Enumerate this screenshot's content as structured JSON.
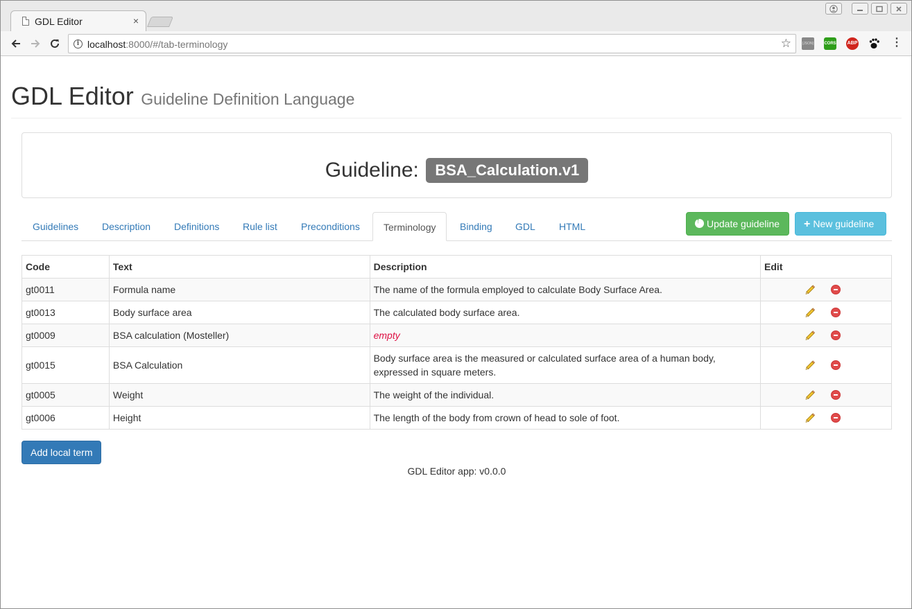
{
  "browser": {
    "tab_title": "GDL Editor",
    "tab_close": "×",
    "url_host": "localhost",
    "url_rest": ":8000/#/tab-terminology",
    "ext_cors": "CORS",
    "ext_abp": "ABP",
    "menu": "⋮"
  },
  "header": {
    "title": "GDL Editor",
    "subtitle": "Guideline Definition Language"
  },
  "guideline_panel": {
    "label": "Guideline:",
    "name": "BSA_Calculation.v1"
  },
  "tabs": [
    {
      "label": "Guidelines",
      "active": false
    },
    {
      "label": "Description",
      "active": false
    },
    {
      "label": "Definitions",
      "active": false
    },
    {
      "label": "Rule list",
      "active": false
    },
    {
      "label": "Preconditions",
      "active": false
    },
    {
      "label": "Terminology",
      "active": true
    },
    {
      "label": "Binding",
      "active": false
    },
    {
      "label": "GDL",
      "active": false
    },
    {
      "label": "HTML",
      "active": false
    }
  ],
  "actions": {
    "update_label": "Update guideline",
    "new_label": "New guideline",
    "add_local_term": "Add local term"
  },
  "table": {
    "headers": [
      "Code",
      "Text",
      "Description",
      "Edit"
    ],
    "rows": [
      {
        "code": "gt0011",
        "text": "Formula name",
        "description": "The name of the formula employed to calculate Body Surface Area."
      },
      {
        "code": "gt0013",
        "text": "Body surface area",
        "description": "The calculated body surface area."
      },
      {
        "code": "gt0009",
        "text": "BSA calculation (Mosteller)",
        "description": "empty"
      },
      {
        "code": "gt0015",
        "text": "BSA Calculation",
        "description": "Body surface area is the measured or calculated surface area of a human body, expressed in square meters."
      },
      {
        "code": "gt0005",
        "text": "Weight",
        "description": "The weight of the individual."
      },
      {
        "code": "gt0006",
        "text": "Height",
        "description": "The length of the body from crown of head to sole of foot."
      }
    ]
  },
  "footer": {
    "version_text": "GDL Editor app: v0.0.0"
  },
  "colors": {
    "link": "#337ab7",
    "success": "#5cb85c",
    "info": "#5bc0de",
    "primary": "#337ab7",
    "badge": "#777777",
    "empty_text": "#dd1144"
  }
}
